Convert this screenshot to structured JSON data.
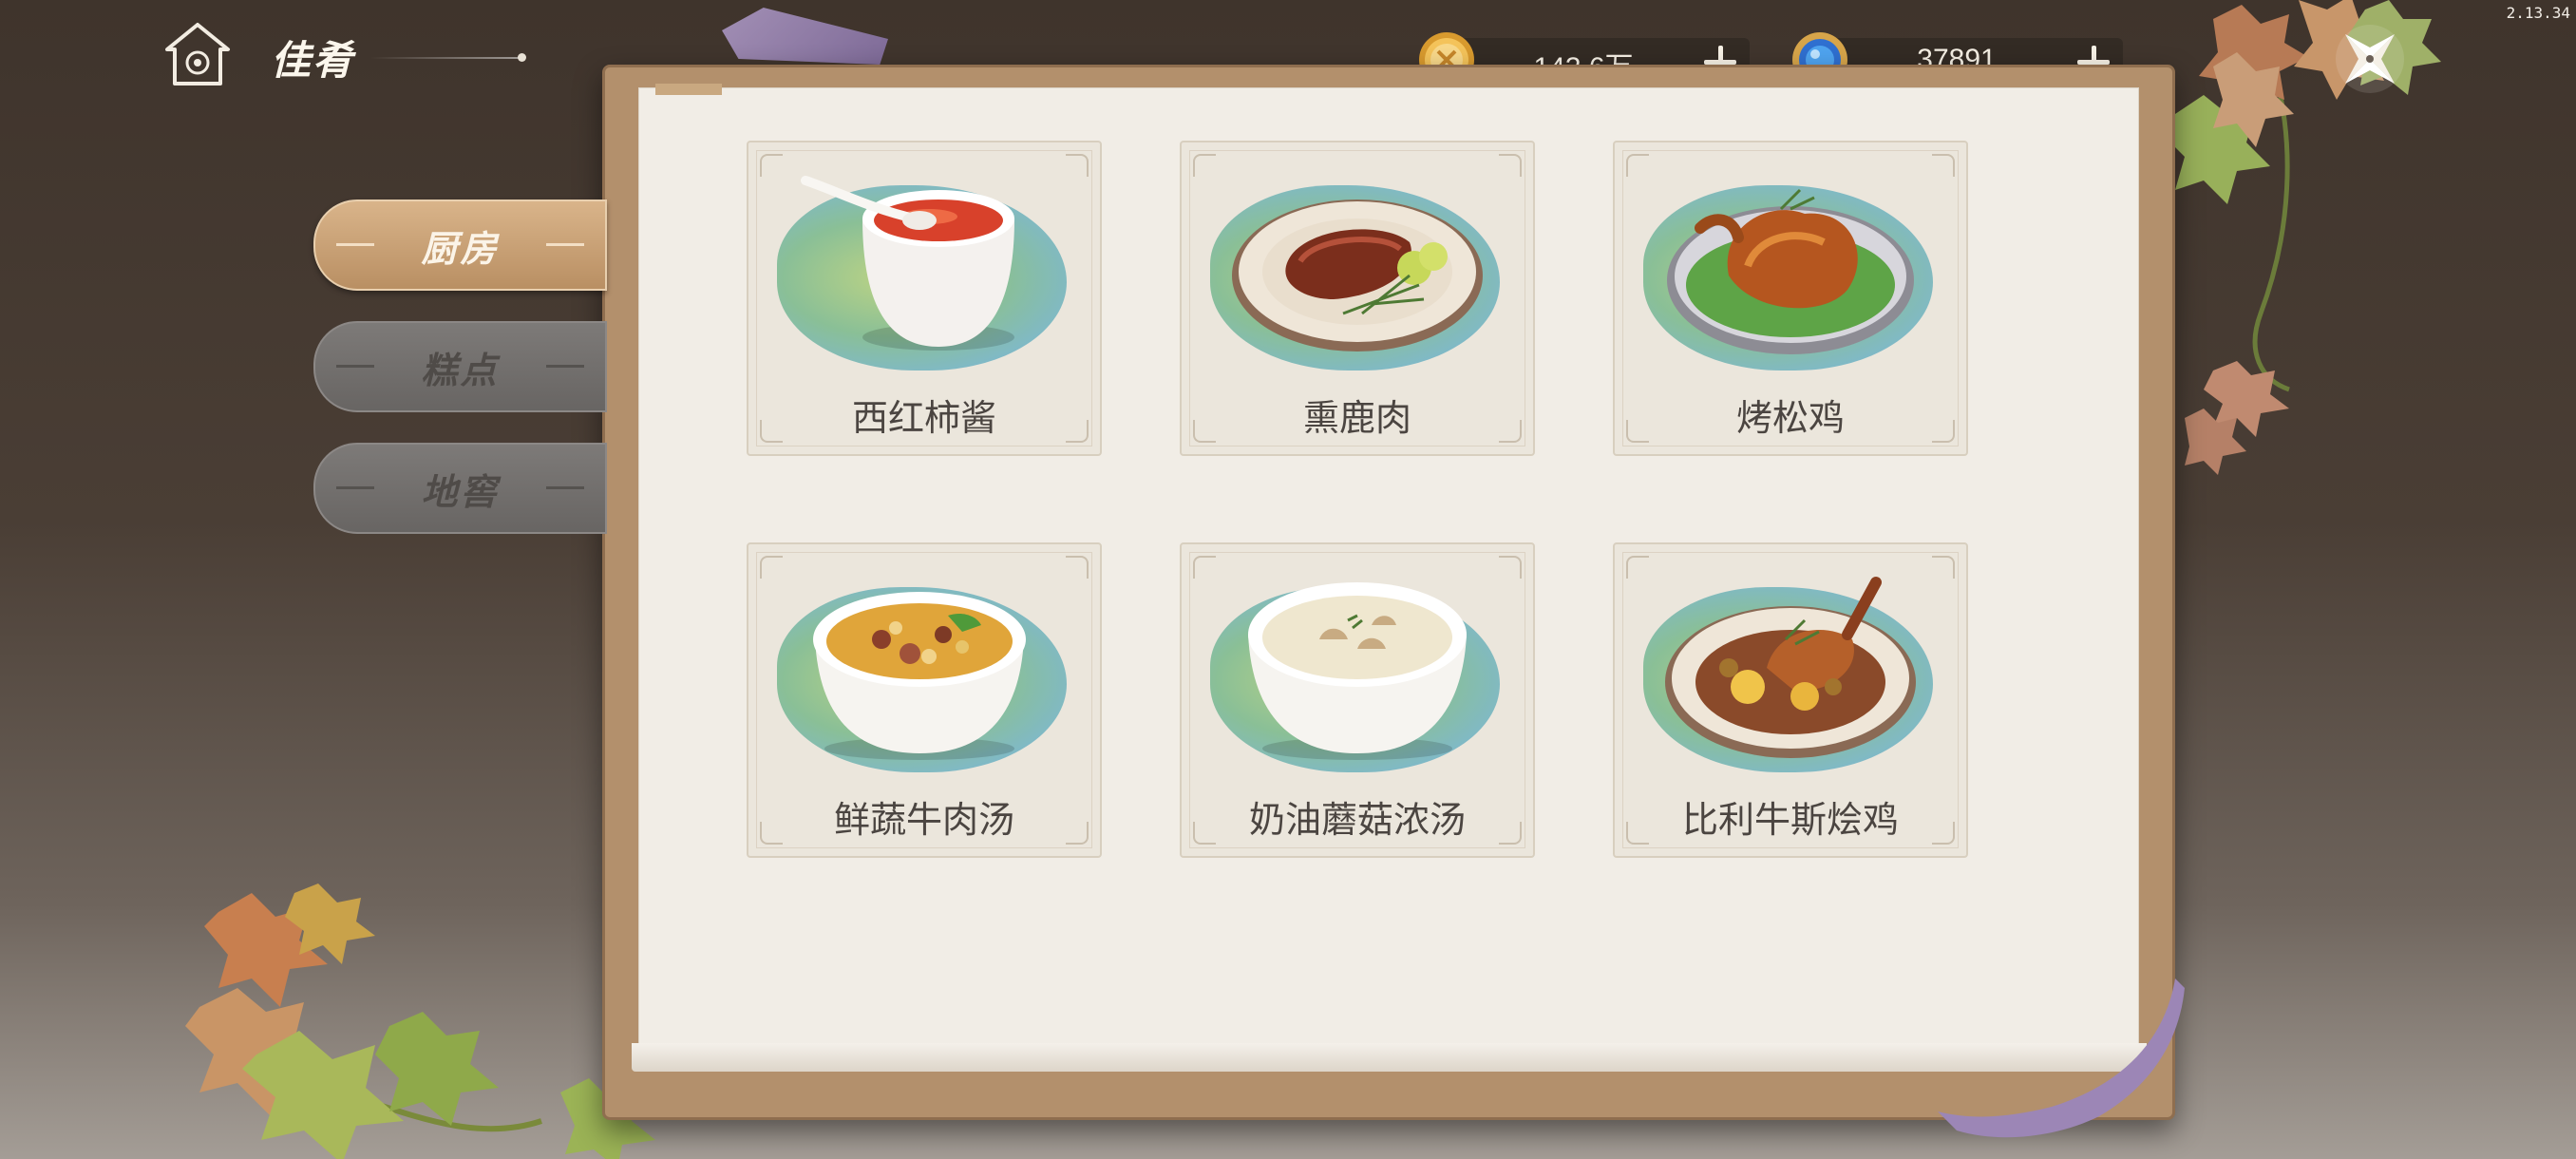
{
  "version": "2.13.34",
  "header": {
    "title": "佳肴",
    "home_icon": "home-icon"
  },
  "currency": {
    "gold": {
      "amount": "143.6万",
      "icon": "gold-coin-icon"
    },
    "gem": {
      "amount": "37891",
      "icon": "blue-gem-icon"
    }
  },
  "close_icon": "close-icon",
  "tabs": [
    {
      "label": "厨房",
      "active": true
    },
    {
      "label": "糕点",
      "active": false
    },
    {
      "label": "地窖",
      "active": false
    }
  ],
  "recipes": [
    {
      "name": "西红柿酱",
      "icon": "tomato-sauce-icon"
    },
    {
      "name": "熏鹿肉",
      "icon": "smoked-venison-icon"
    },
    {
      "name": "烤松鸡",
      "icon": "roast-grouse-icon"
    },
    {
      "name": "鲜蔬牛肉汤",
      "icon": "beef-vegetable-soup-icon"
    },
    {
      "name": "奶油蘑菇浓汤",
      "icon": "cream-mushroom-soup-icon"
    },
    {
      "name": "比利牛斯烩鸡",
      "icon": "pyrenees-chicken-stew-icon"
    }
  ],
  "colors": {
    "accent_tab": "#c9a173",
    "page": "#f1ede6",
    "book_frame": "#b3906c",
    "text_dark": "#4b4541"
  }
}
